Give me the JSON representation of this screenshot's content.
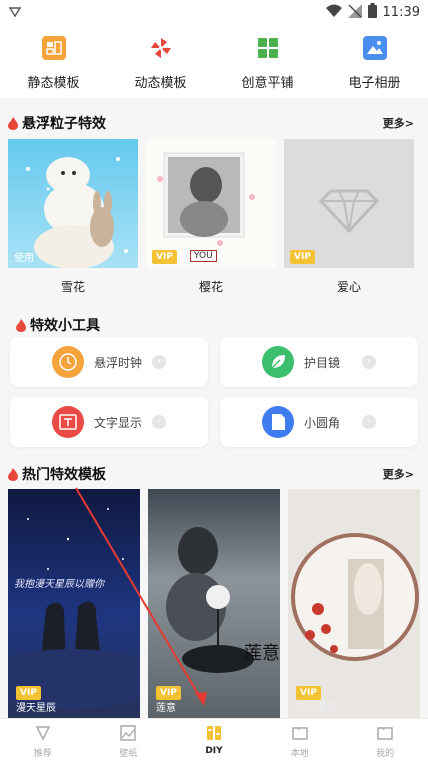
{
  "status": {
    "time": "11:39"
  },
  "top_nav": [
    {
      "label": "静态模板",
      "icon": "static-template-icon",
      "color": "#f5a43a"
    },
    {
      "label": "动态模板",
      "icon": "pinwheel-icon",
      "color": "#e8473c"
    },
    {
      "label": "创意平铺",
      "icon": "grid-icon",
      "color": "#4caf50"
    },
    {
      "label": "电子相册",
      "icon": "photo-album-icon",
      "color": "#4a8ef0"
    }
  ],
  "section1": {
    "title": "悬浮粒子特效",
    "more": "更多>",
    "cards": [
      {
        "caption": "雪花",
        "overlay": "使用",
        "vip": ""
      },
      {
        "caption": "樱花",
        "overlay": "YOU",
        "vip": "VIP"
      },
      {
        "caption": "爱心",
        "overlay": "",
        "vip": "VIP"
      }
    ]
  },
  "section2": {
    "title": "特效小工具",
    "tools": [
      {
        "label": "悬浮时钟",
        "icon": "clock-icon",
        "color": "#f6a33b"
      },
      {
        "label": "护目镜",
        "icon": "leaf-icon",
        "color": "#3bbf6c"
      },
      {
        "label": "文字显示",
        "icon": "text-display-icon",
        "color": "#ea4a45"
      },
      {
        "label": "小圆角",
        "icon": "rounded-corner-icon",
        "color": "#3f7cf0"
      }
    ]
  },
  "section3": {
    "title": "热门特效模板",
    "more": "更多>",
    "cards": [
      {
        "caption": "漫天星辰",
        "vip": "VIP",
        "art_text": "我抱漫天星辰以赠你"
      },
      {
        "caption": "莲意",
        "vip": "VIP",
        "art_text": "莲意"
      },
      {
        "caption": "花间漫画",
        "vip": "VIP"
      }
    ]
  },
  "tabbar": [
    {
      "label": "推荐",
      "icon": "recommend-icon",
      "active": false
    },
    {
      "label": "壁纸",
      "icon": "wallpaper-icon",
      "active": false
    },
    {
      "label": "DIY",
      "icon": "diy-icon",
      "active": true
    },
    {
      "label": "本地",
      "icon": "local-folder-icon",
      "active": false
    },
    {
      "label": "我的",
      "icon": "profile-folder-icon",
      "active": false
    }
  ],
  "accent": "#f5c233",
  "flame_color": "#e8473c"
}
